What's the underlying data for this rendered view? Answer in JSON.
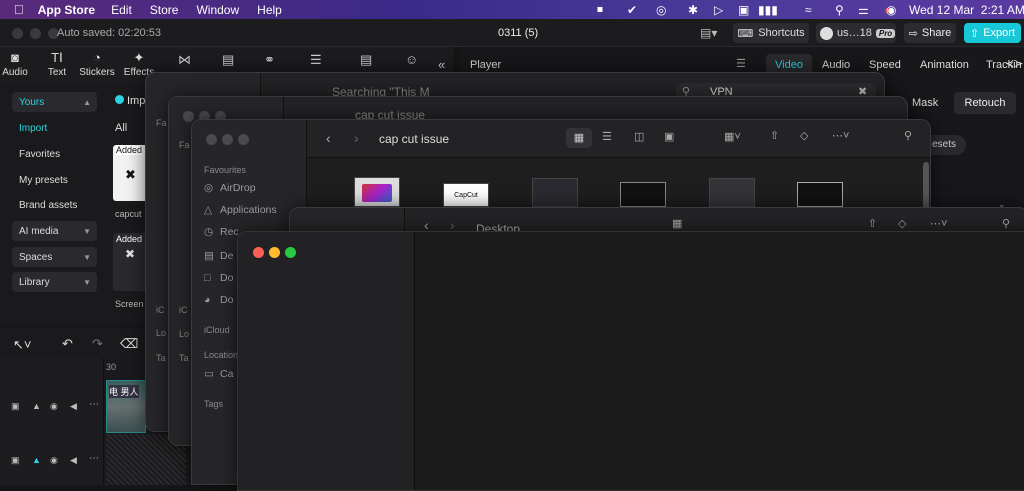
{
  "menubar": {
    "app": "App Store",
    "items": [
      "Edit",
      "Store",
      "Window",
      "Help"
    ],
    "datetime": "Wed 12 Mar  2:21 AM"
  },
  "app": {
    "autosave": "Auto saved: 02:20:53",
    "project_title": "0311 (5)",
    "shortcuts": "Shortcuts",
    "user": "us…18",
    "pro": "Pro",
    "share": "Share",
    "export": "Export"
  },
  "toolbar": {
    "tools": [
      "Audio",
      "Text",
      "Stickers",
      "Effects"
    ]
  },
  "sidebar": {
    "yours": "Yours",
    "import": "Import",
    "favorites": "Favorites",
    "my_presets": "My presets",
    "brand_assets": "Brand assets",
    "ai_media": "AI media",
    "spaces": "Spaces",
    "library": "Library"
  },
  "media": {
    "import_tab": "Imp",
    "filter_all": "All",
    "added1": "Added",
    "name1": "capcut",
    "added2": "Added",
    "name2": "Screen"
  },
  "rightpanel": {
    "player": "Player",
    "tabs": [
      "Video",
      "Audio",
      "Speed",
      "Animation",
      "Tracking"
    ],
    "subtabs": [
      "Mask",
      "Retouch"
    ],
    "presets": "esets"
  },
  "timeline": {
    "ruler_mark": "30",
    "clip_text": "电  男人"
  },
  "finder_back2": {
    "title": "Searching \"This M",
    "search_value": "VPN"
  },
  "finder_back1": {
    "title": "cap cut issue"
  },
  "finder_main": {
    "title": "cap cut issue",
    "favourites_label": "Favourites",
    "fav_items": [
      "AirDrop",
      "Applications",
      "Rec",
      "De",
      "Do",
      "Do"
    ],
    "icloud_label": "iCloud",
    "locations_label": "Location",
    "loc_item": "Ca",
    "tags_label": "Tags",
    "file_logo": "CapCut"
  },
  "finder_desktop": {
    "title": "Desktop"
  },
  "back_sidebar_labels": [
    "Fa",
    "Fa",
    "iC",
    "Lo",
    "Ta",
    "iC",
    "Lo",
    "Ta"
  ]
}
